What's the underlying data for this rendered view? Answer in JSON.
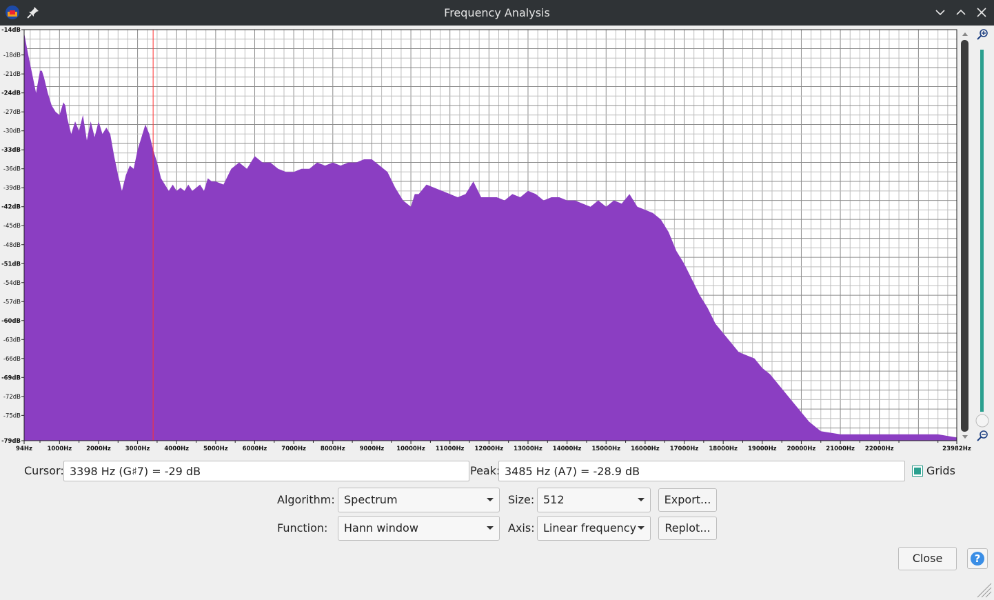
{
  "window": {
    "title": "Frequency Analysis"
  },
  "chart_data": {
    "type": "area",
    "title": "",
    "xlabel": "",
    "ylabel": "",
    "fill_color": "#8b3ec2",
    "grid": true,
    "xlim": [
      94,
      23982
    ],
    "ylim": [
      -79,
      -14
    ],
    "x_tick_labels": [
      "94Hz",
      "1000Hz",
      "2000Hz",
      "3000Hz",
      "4000Hz",
      "5000Hz",
      "6000Hz",
      "7000Hz",
      "8000Hz",
      "9000Hz",
      "10000Hz",
      "11000Hz",
      "12000Hz",
      "13000Hz",
      "14000Hz",
      "15000Hz",
      "16000Hz",
      "17000Hz",
      "18000Hz",
      "19000Hz",
      "20000Hz",
      "21000Hz",
      "22000Hz",
      "23982Hz"
    ],
    "x_tick_values": [
      94,
      1000,
      2000,
      3000,
      4000,
      5000,
      6000,
      7000,
      8000,
      9000,
      10000,
      11000,
      12000,
      13000,
      14000,
      15000,
      16000,
      17000,
      18000,
      19000,
      20000,
      21000,
      22000,
      23982
    ],
    "y_tick_labels": [
      "-14dB",
      "-18dB",
      "-21dB",
      "-24dB",
      "-27dB",
      "-30dB",
      "-33dB",
      "-36dB",
      "-39dB",
      "-42dB",
      "-45dB",
      "-48dB",
      "-51dB",
      "-54dB",
      "-57dB",
      "-60dB",
      "-63dB",
      "-66dB",
      "-69dB",
      "-72dB",
      "-75dB",
      "-79dB"
    ],
    "y_tick_values": [
      -14,
      -18,
      -21,
      -24,
      -27,
      -30,
      -33,
      -36,
      -39,
      -42,
      -45,
      -48,
      -51,
      -54,
      -57,
      -60,
      -63,
      -66,
      -69,
      -72,
      -75,
      -79
    ],
    "cursor_line_hz": 3398,
    "x": [
      94,
      200,
      300,
      400,
      500,
      550,
      600,
      700,
      800,
      900,
      1000,
      1100,
      1150,
      1200,
      1300,
      1400,
      1500,
      1600,
      1700,
      1800,
      1900,
      2000,
      2100,
      2200,
      2300,
      2400,
      2500,
      2600,
      2700,
      2800,
      2900,
      3000,
      3100,
      3200,
      3300,
      3400,
      3500,
      3600,
      3700,
      3800,
      3900,
      4000,
      4100,
      4200,
      4300,
      4400,
      4500,
      4600,
      4700,
      4800,
      4900,
      5000,
      5200,
      5400,
      5600,
      5800,
      6000,
      6200,
      6400,
      6600,
      6800,
      7000,
      7200,
      7400,
      7600,
      7800,
      8000,
      8200,
      8400,
      8600,
      8800,
      9000,
      9200,
      9400,
      9600,
      9800,
      10000,
      10100,
      10200,
      10400,
      10600,
      10800,
      11000,
      11200,
      11400,
      11600,
      11800,
      12000,
      12200,
      12400,
      12600,
      12800,
      13000,
      13200,
      13400,
      13600,
      13800,
      14000,
      14200,
      14400,
      14600,
      14800,
      15000,
      15200,
      15400,
      15600,
      15800,
      16000,
      16200,
      16400,
      16600,
      16800,
      17000,
      17200,
      17400,
      17600,
      17800,
      18000,
      18200,
      18400,
      18600,
      18800,
      19000,
      19200,
      19400,
      19600,
      19800,
      20000,
      20200,
      20500,
      21000,
      21500,
      22000,
      22500,
      23000,
      23500,
      23982
    ],
    "y": [
      -14.5,
      -18,
      -21,
      -24,
      -20.5,
      -20.5,
      -21.5,
      -24,
      -26,
      -27,
      -27.5,
      -25.5,
      -26,
      -28,
      -30.5,
      -28.5,
      -30,
      -27.5,
      -31.5,
      -28.5,
      -31,
      -28.5,
      -30.5,
      -29.5,
      -30.5,
      -34,
      -37,
      -39.5,
      -37,
      -35.5,
      -36,
      -33,
      -31,
      -29,
      -30.5,
      -33,
      -35,
      -37.5,
      -38.5,
      -39.5,
      -38.5,
      -39.5,
      -39,
      -39.5,
      -38.5,
      -39.5,
      -39,
      -38.5,
      -39.5,
      -37.5,
      -38,
      -38,
      -38.5,
      -36,
      -35,
      -36,
      -34,
      -35,
      -35,
      -36,
      -36.5,
      -36.5,
      -36,
      -36,
      -35,
      -35.5,
      -35,
      -35.5,
      -35,
      -35,
      -34.5,
      -34.5,
      -35.5,
      -36.5,
      -39,
      -41,
      -42,
      -40,
      -40,
      -38.5,
      -39,
      -39.5,
      -40,
      -40.5,
      -40,
      -38,
      -40.5,
      -40.5,
      -40.5,
      -41,
      -40,
      -40.5,
      -39.5,
      -40,
      -41,
      -40.5,
      -40.5,
      -41,
      -41,
      -41.5,
      -42,
      -41,
      -42,
      -41,
      -41.5,
      -40,
      -42,
      -42.5,
      -43,
      -44,
      -46,
      -49,
      -51,
      -53.5,
      -56,
      -58,
      -60.5,
      -62,
      -63.5,
      -65,
      -65.5,
      -66,
      -67.5,
      -68.5,
      -70,
      -71.5,
      -73,
      -74.5,
      -76,
      -77.5,
      -78,
      -78,
      -78,
      -78,
      -78,
      -78,
      -78.5,
      -78.5,
      -79
    ]
  },
  "cursor_label": "Cursor:",
  "cursor_value": "3398 Hz (G♯7) = -29 dB",
  "peak_label": "Peak:",
  "peak_value": "3485 Hz (A7) = -28.9 dB",
  "grids_label": "Grids",
  "grids_checked": true,
  "algorithm_label": "Algorithm:",
  "algorithm_value": "Spectrum",
  "size_label": "Size:",
  "size_value": "512",
  "export_label": "Export...",
  "function_label": "Function:",
  "function_value": "Hann window",
  "axis_label": "Axis:",
  "axis_value": "Linear frequency",
  "replot_label": "Replot...",
  "close_label": "Close",
  "help_label": "?",
  "icons": [
    "app-icon",
    "pin-icon",
    "minimize-icon",
    "maximize-icon",
    "close-icon",
    "zoom-in-icon",
    "zoom-out-icon",
    "help-icon",
    "resize-grip-icon"
  ]
}
